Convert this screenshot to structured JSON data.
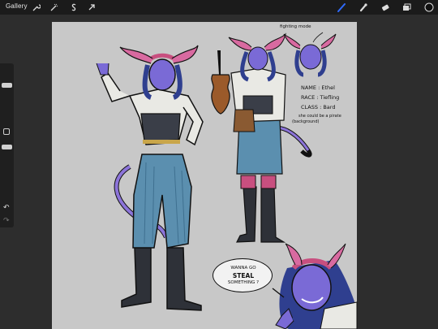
{
  "app": {
    "gallery_label": "Gallery"
  },
  "toolbar_left": [
    "wrench-icon",
    "magic-wand-icon",
    "selection-s-icon",
    "transform-arrow-icon"
  ],
  "toolbar_right": [
    "brush-icon",
    "smudge-icon",
    "eraser-icon",
    "layers-icon",
    "color-swatch"
  ],
  "accent_color": "#2f6bff",
  "sheet": {
    "fighting_mode": "fighting mode",
    "name": "NAME : Ethel",
    "race": "RACE : Tiefling",
    "class": "CLASS : Bard",
    "note_line1": "she could be a pirate",
    "note_line2": "(background)",
    "speech_line1": "WANNA GO",
    "speech_line2": "STEAL",
    "speech_line3": "SOMETHING ?"
  }
}
